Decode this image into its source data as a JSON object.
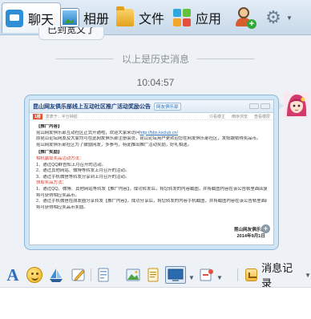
{
  "tabs": [
    {
      "label": "聊天",
      "icon": "chat-icon",
      "active": true
    },
    {
      "label": "相册",
      "icon": "photo-album-icon",
      "active": false
    },
    {
      "label": "文件",
      "icon": "folder-icon",
      "active": false
    },
    {
      "label": "应用",
      "icon": "apps-icon",
      "active": false
    }
  ],
  "header_icons": {
    "add_friend": "add-friend-icon",
    "settings": "gear-icon"
  },
  "history": {
    "partial_message": "已到宽文了",
    "divider_text": "以上是历史消息",
    "timestamp": "10:04:57"
  },
  "message_doc": {
    "title": "昆山网友俱乐部线上互动社区推广活动奖励公告",
    "badge": "网友俱乐部",
    "meta_tag": "1楼",
    "meta_author": "发表于：半分钟前",
    "meta_links": [
      "只看楼主",
      "倒序浏览",
      "查看楼层"
    ],
    "lines": [
      {
        "text": "【推广内容】",
        "style": "sec"
      },
      {
        "text": "昆山网友俱乐部互动社区正式开通啦，欢迎大家来访问",
        "link": "http://bbs.ksclub.cn/",
        "style": ""
      },
      {
        "text": "原昆山论坛网友及大家均可在此网友俱乐部注册会员，昆山论坛用户更欢迎您在网友俱乐部社区，发帖跟帖得奖品币。",
        "style": ""
      },
      {
        "text": "昆山网友俱乐部社区为了鼓励网友，多参与，特此推出推广活动奖励，好礼相送。",
        "style": ""
      },
      {
        "text": "【推广奖励】",
        "style": "sec"
      },
      {
        "text": "相机赢取奖品活动方法：",
        "style": "red"
      },
      {
        "text": "1、通过QQ群告知上月召开的活动。",
        "style": ""
      },
      {
        "text": "2、通过其他网站、微博等转发上月召开的活动。",
        "style": ""
      },
      {
        "text": "3、通过手机微信等转发分享到上月召开的活动。",
        "style": ""
      },
      {
        "text": "领取奖品方法：",
        "style": "red"
      },
      {
        "text": "1、通过QQ、微博、其他网站等转发【推广内容】，成功转发后，将您转发的内容截图，并将截图内容在该公告帖里面回复，",
        "style": ""
      },
      {
        "text": "将可获得相应奖品币。",
        "style": ""
      },
      {
        "text": "2、通过手机微信在朋友圈分享转发【推广内容】，成功分享后，将您转发的内容手机截图，并将截图内容在该公告帖里面回复，",
        "style": ""
      },
      {
        "text": "将可获得相应奖品币奖励。",
        "style": ""
      }
    ],
    "sign_name": "昆山网友俱乐部",
    "sign_date": "2014年9月1日"
  },
  "toolbar": {
    "history_label": "消息记录",
    "icons": [
      "font-icon",
      "emoji-icon",
      "sailboat-icon",
      "pencil-icon",
      "card-icon",
      "image-icon",
      "note-icon",
      "screenshot-icon",
      "shake-icon"
    ]
  },
  "colors": {
    "accent": "#2c6fbd",
    "bubble": "#cfe6f7",
    "doc_title": "#173c78",
    "highlight_red": "#d83a2a"
  }
}
